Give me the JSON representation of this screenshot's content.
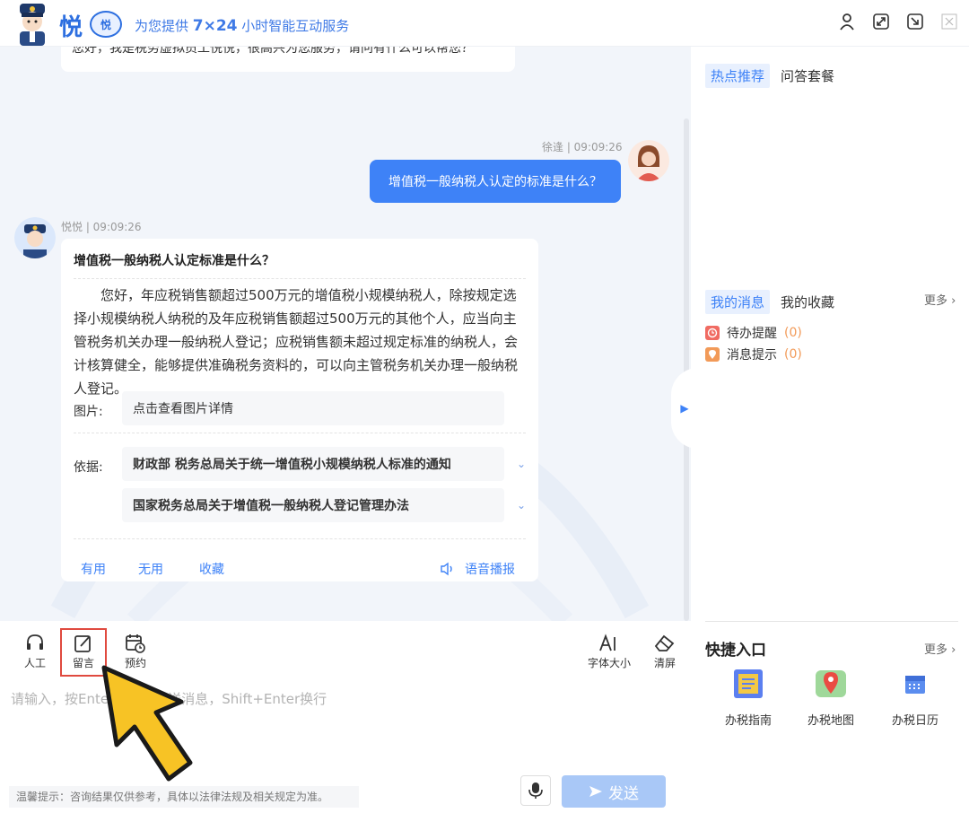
{
  "header": {
    "brand": "悦",
    "badge": "悦",
    "slogan_prefix": "为您提供 ",
    "slogan_highlight": "7×24",
    "slogan_suffix": " 小时智能互动服务",
    "icons": [
      "user-icon",
      "expand-icon",
      "minimize-icon",
      "close-icon"
    ]
  },
  "chat": {
    "greeting": "您好，我是税务虚拟员工悦悦，很高兴为您服务，请问有什么可以帮您？",
    "user_meta": "徐逢 | 09:09:26",
    "user_message": "增值税一般纳税人认定的标准是什么？",
    "bot_meta": "悦悦 | 09:09:26",
    "answer": {
      "title": "增值税一般纳税人认定标准是什么？",
      "body": "您好，年应税销售额超过500万元的增值税小规模纳税人，除按规定选择小规模纳税人纳税的及年应税销售额超过500万元的其他个人，应当向主管税务机关办理一般纳税人登记；应税销售额未超过规定标准的纳税人，会计核算健全，能够提供准确税务资料的，可以向主管税务机关办理一般纳税人登记。",
      "image_label": "图片:",
      "image_link": "点击查看图片详情",
      "basis_label": "依据:",
      "basis": [
        "财政部 税务总局关于统一增值税小规模纳税人标准的通知",
        "国家税务总局关于增值税一般纳税人登记管理办法"
      ],
      "actions": {
        "useful": "有用",
        "useless": "无用",
        "favorite": "收藏",
        "voice": "语音播报"
      }
    }
  },
  "toolbar": {
    "human": "人工",
    "message": "留言",
    "appointment": "预约",
    "font_size": "字体大小",
    "clear": "清屏"
  },
  "input": {
    "placeholder": "请输入，按Enter键直接发送消息，Shift+Enter换行",
    "tip": "温馨提示：咨询结果仅供参考，具体以法律法规及相关规定为准。",
    "send": "发送"
  },
  "right_panel": {
    "tabs1": [
      "热点推荐",
      "问答套餐"
    ],
    "tabs2": [
      "我的消息",
      "我的收藏"
    ],
    "more": "更多",
    "messages": [
      {
        "label": "待办提醒",
        "count": "(0)"
      },
      {
        "label": "消息提示",
        "count": "(0)"
      }
    ],
    "quick_title": "快捷入口",
    "quick_more": "更多",
    "quick": [
      "办税指南",
      "办税地图",
      "办税日历"
    ]
  },
  "colors": {
    "accent": "#3e82f7",
    "highlight_border": "#e04a3f",
    "cursor": "#f7c325"
  }
}
